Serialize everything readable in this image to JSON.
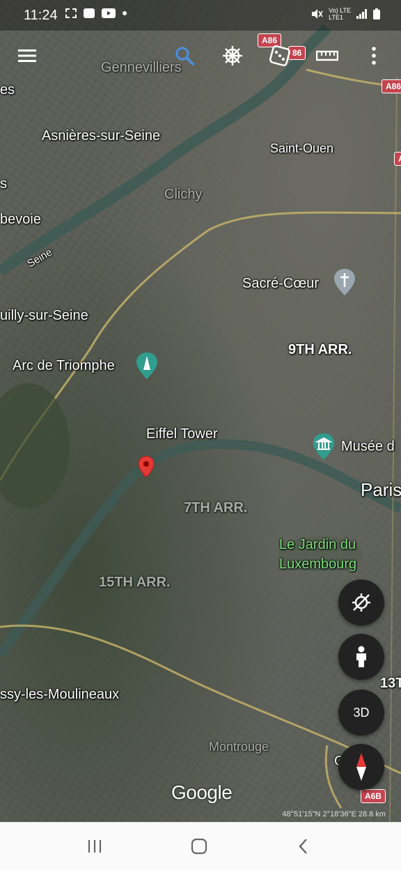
{
  "status_bar": {
    "time": "11:24",
    "network": "Vo) LTE\nLTE1",
    "icons": [
      "screenshot-icon",
      "app-icon",
      "youtube-icon",
      "notification-dot-icon",
      "mute-icon",
      "signal-icon",
      "battery-icon"
    ]
  },
  "toolbar": {
    "icons": [
      "menu-icon",
      "search-icon",
      "voyager-icon",
      "dice-icon",
      "ruler-icon",
      "more-icon"
    ]
  },
  "map": {
    "places": {
      "gennevilliers": "Gennevilliers",
      "es": "es",
      "asnieres": "Asnières-sur-Seine",
      "saint_ouen": "Saint-Ouen",
      "s_left": "s",
      "clichy": "Clichy",
      "bevoie": "bevoie",
      "seine": "Seine",
      "sacre_coeur": "Sacré-Cœur",
      "neuilly": "uilly-sur-Seine",
      "arr9": "9TH ARR.",
      "arc": "Arc de Triomphe",
      "eiffel": "Eiffel Tower",
      "musee": "Musée d",
      "paris": "Paris",
      "arr7": "7TH ARR.",
      "jardin_line1": "Le Jardin du",
      "jardin_line2": "Luxembourg",
      "arr15": "15TH ARR.",
      "issy": "ssy-les-Moulineaux",
      "arr13": "13T",
      "montrouge": "Montrouge",
      "g": "G"
    },
    "road_badges": {
      "a86_top": "A86",
      "a86_mid": "86",
      "a86_right": "A86",
      "a_right": "A",
      "a6b": "A6B"
    },
    "attribution": "Google",
    "coordinates": "48°51'15\"N 2°18'36\"E 28.8 km"
  },
  "controls": {
    "three_d": "3D",
    "icons": [
      "recenter-icon",
      "pegman-icon",
      "compass-icon"
    ]
  },
  "nav_bar": {
    "icons": [
      "recents-icon",
      "home-icon",
      "back-icon"
    ]
  },
  "colors": {
    "accent_red": "#e53935",
    "road_yellow": "#cbb56a",
    "river": "#3e5a55",
    "fab_bg": "#222222"
  }
}
